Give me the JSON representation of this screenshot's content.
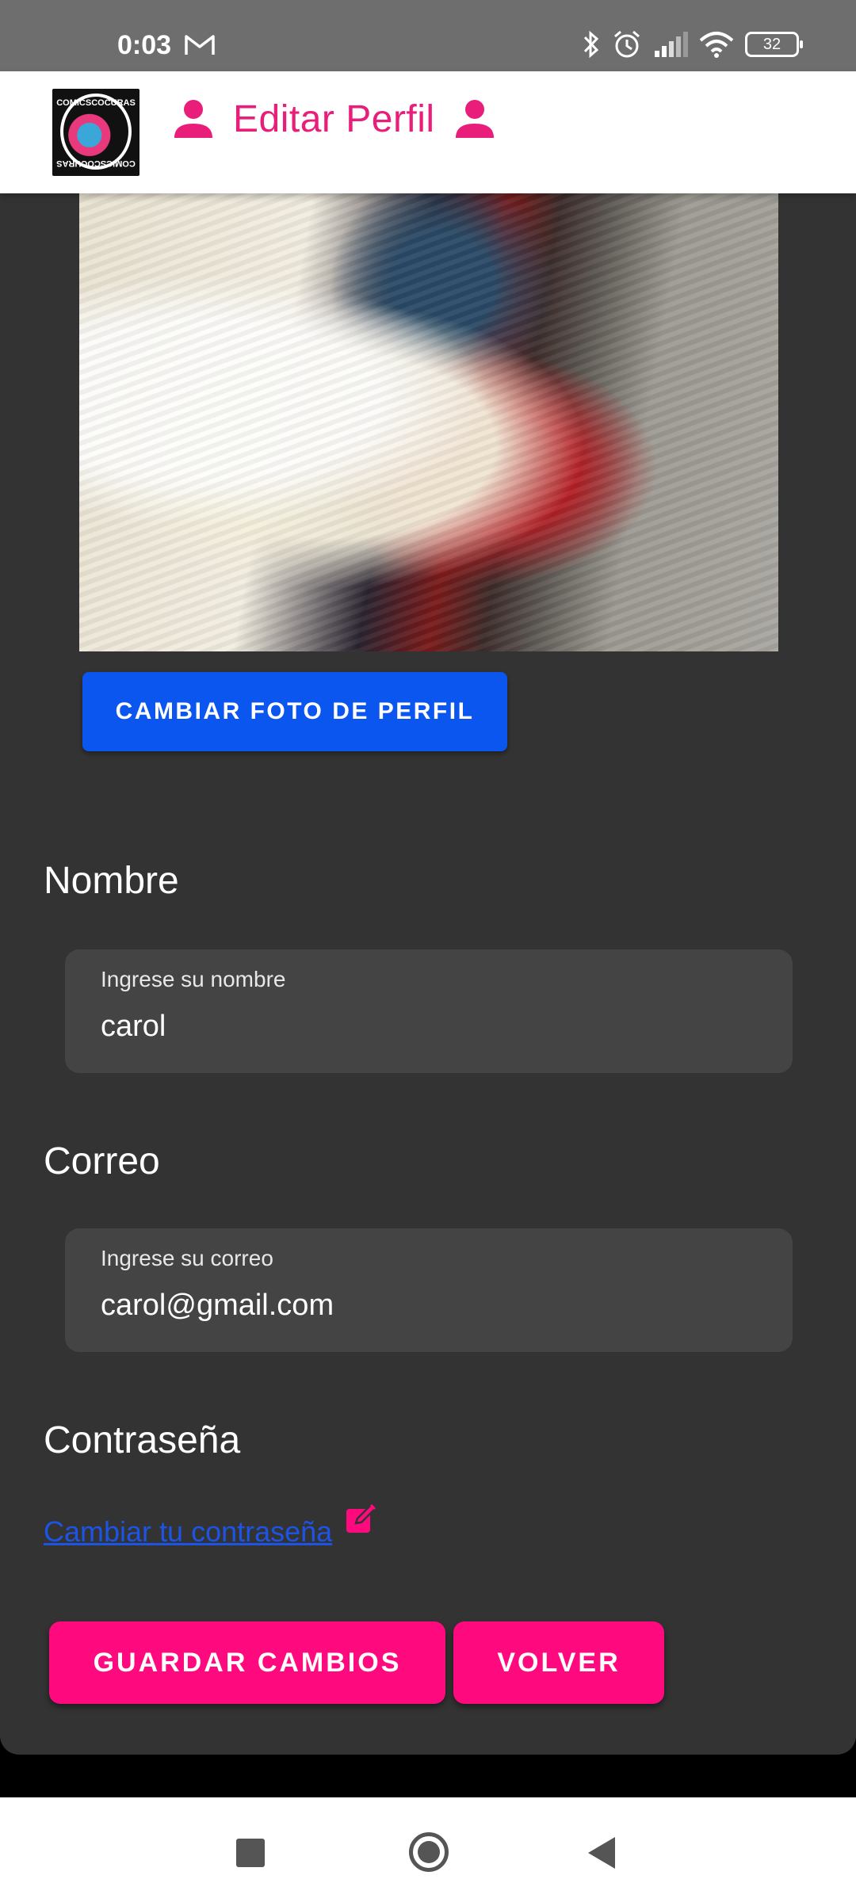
{
  "status_bar": {
    "time": "0:03",
    "battery": "32",
    "icons": [
      "gmail-icon",
      "bluetooth-icon",
      "alarm-icon",
      "signal-icon",
      "wifi-icon",
      "battery-icon"
    ]
  },
  "app_bar": {
    "logo_text_top": "COMICSCOCURAS",
    "logo_text_bottom": "COMICSCOCURAS",
    "title": "Editar Perfil",
    "icons": [
      "person-icon",
      "person-icon"
    ]
  },
  "profile": {
    "change_photo_button": "CAMBIAR FOTO DE PERFIL"
  },
  "form": {
    "name_section": "Nombre",
    "name_label": "Ingrese su nombre",
    "name_value": "carol",
    "email_section": "Correo",
    "email_label": "Ingrese su correo",
    "email_value": "carol@gmail.com",
    "password_section": "Contraseña",
    "change_password_link": "Cambiar tu contraseña"
  },
  "actions": {
    "save_button": "GUARDAR CAMBIOS",
    "back_button": "VOLVER"
  },
  "colors": {
    "accent_pink": "#ff0a7e",
    "title_pink": "#e91e7a",
    "primary_blue": "#0b56ef",
    "card_bg": "#333333",
    "field_bg": "#444444"
  }
}
